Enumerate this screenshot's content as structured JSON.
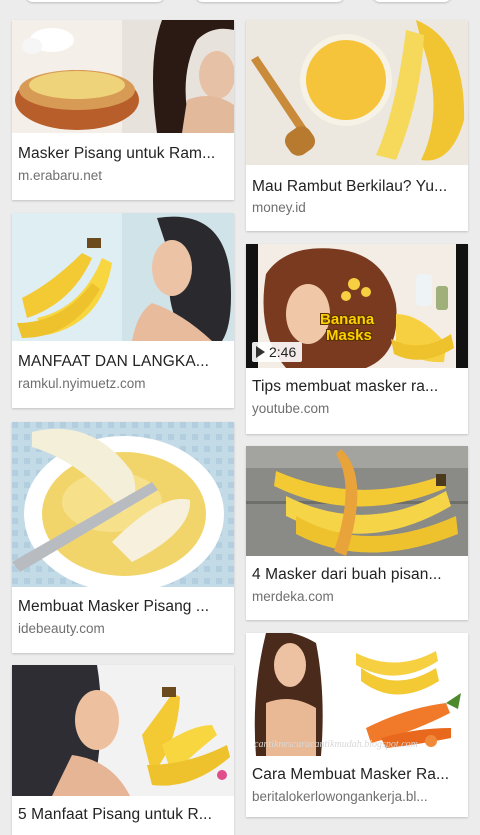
{
  "results": [
    {
      "title": "Masker Pisang untuk Ram...",
      "domain": "m.erabaru.net"
    },
    {
      "title": "Mau Rambut Berkilau? Yu...",
      "domain": "money.id"
    },
    {
      "title": "MANFAAT DAN LANGKA...",
      "domain": "ramkul.nyimuetz.com"
    },
    {
      "title": "Tips membuat masker ra...",
      "domain": "youtube.com",
      "duration": "2:46",
      "thumb_text": [
        "Banana",
        "Masks"
      ]
    },
    {
      "title": "Membuat Masker Pisang ...",
      "domain": "idebeauty.com"
    },
    {
      "title": "4 Masker dari buah pisan...",
      "domain": "merdeka.com"
    },
    {
      "title": "5 Manfaat Pisang untuk R...",
      "domain": ""
    },
    {
      "title": "Cara Membuat Masker Ra...",
      "domain": "beritalokerlowongankerja.bl...",
      "thumb_text": [
        "cantiknescaracantikmudah.blogspot.com"
      ]
    }
  ],
  "colors": {
    "background": "#ececec",
    "card": "#ffffff",
    "title": "#222222",
    "domain": "#6f6f6f"
  }
}
